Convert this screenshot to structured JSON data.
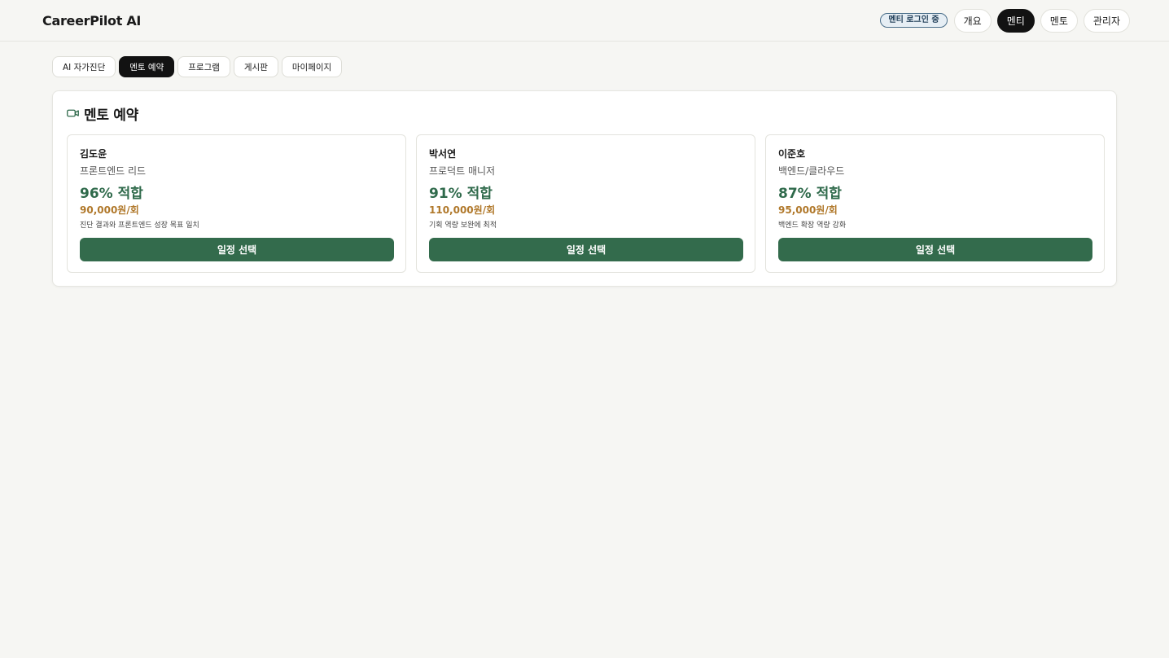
{
  "header": {
    "brand": "CareerPilot AI",
    "login_status": "멘티 로그인 중",
    "roles": [
      {
        "label": "개요",
        "active": false
      },
      {
        "label": "멘티",
        "active": true
      },
      {
        "label": "멘토",
        "active": false
      },
      {
        "label": "관리자",
        "active": false
      }
    ]
  },
  "tabs": [
    {
      "label": "AI 자가진단",
      "active": false
    },
    {
      "label": "멘토 예약",
      "active": true
    },
    {
      "label": "프로그램",
      "active": false
    },
    {
      "label": "게시판",
      "active": false
    },
    {
      "label": "마이페이지",
      "active": false
    }
  ],
  "section": {
    "icon": "video-camera-icon",
    "title": "멘토 예약"
  },
  "mentors": [
    {
      "name": "김도윤",
      "role": "프론트엔드 리드",
      "match": "96% 적합",
      "price": "90,000원/회",
      "reason": "진단 결과와 프론트엔드 성장 목표 일치",
      "button": "일정 선택"
    },
    {
      "name": "박서연",
      "role": "프로덕트 매니저",
      "match": "91% 적합",
      "price": "110,000원/회",
      "reason": "기획 역량 보완에 최적",
      "button": "일정 선택"
    },
    {
      "name": "이준호",
      "role": "백엔드/클라우드",
      "match": "87% 적합",
      "price": "95,000원/회",
      "reason": "백엔드 확장 역량 강화",
      "button": "일정 선택"
    }
  ],
  "colors": {
    "accent_green": "#336b4c",
    "match_green": "#2f6a4b",
    "price_amber": "#b0782a",
    "active_dark": "#121212"
  }
}
